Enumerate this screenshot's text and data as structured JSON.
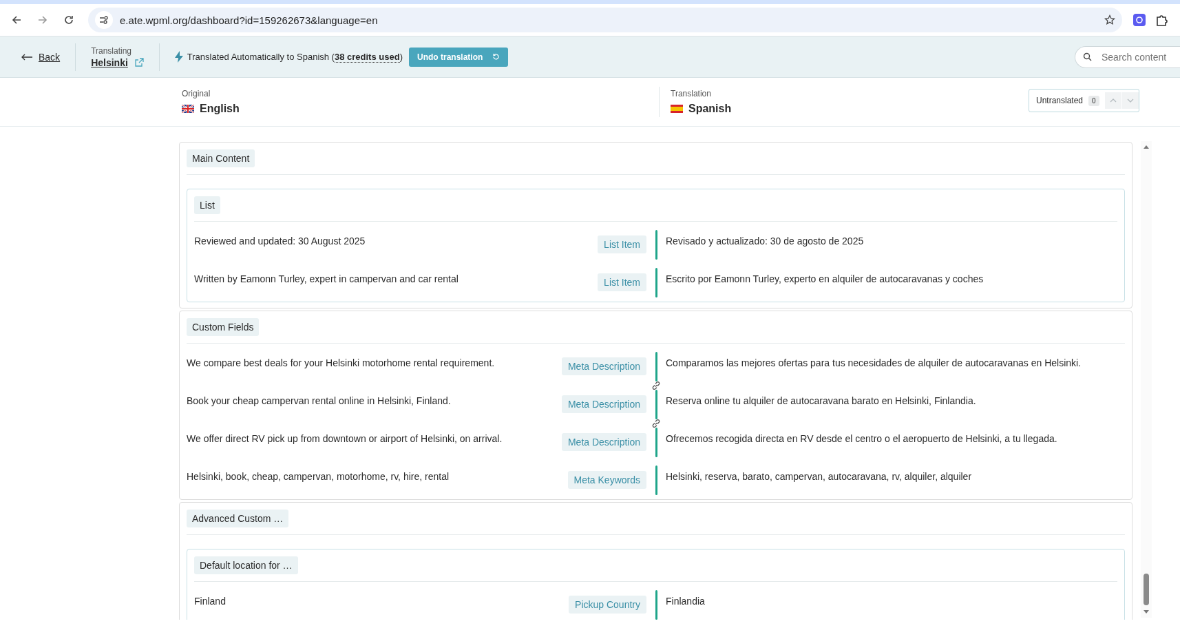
{
  "browser": {
    "url": "e.ate.wpml.org/dashboard?id=159262673&language=en"
  },
  "header": {
    "back": "Back",
    "translating_label": "Translating",
    "post_title": "Helsinki",
    "status": "Translated Automatically to Spanish (**38 credits used**)",
    "undo_button": "Undo translation",
    "search": {
      "placeholder": "Search content"
    }
  },
  "languages": {
    "original": {
      "label": "Original",
      "name": "English"
    },
    "translation": {
      "label": "Translation",
      "name": "Spanish"
    },
    "untranslated": {
      "label": "Untranslated",
      "count": "0"
    }
  },
  "sections": [
    {
      "title": "Main Content",
      "items": [
        {
          "kind": "group",
          "title": "List",
          "rows": [
            {
              "source": "Reviewed and updated: 30 August 2025",
              "field": "List Item",
              "target": "Revisado y actualizado: 30 de agosto de 2025",
              "linked_to_next": false
            },
            {
              "source": "Written by Eamonn Turley, expert in campervan and car rental",
              "field": "List Item",
              "target": "Escrito por Eamonn Turley, experto en alquiler de autocaravanas y coches",
              "linked_to_next": false
            }
          ]
        }
      ]
    },
    {
      "title": "Custom Fields",
      "items": [
        {
          "kind": "row",
          "source": "We compare best deals for your Helsinki motorhome rental requirement.",
          "field": "Meta Description",
          "target": "Comparamos las mejores ofertas para tus necesidades de alquiler de autocaravanas en Helsinki.",
          "linked_to_next": true
        },
        {
          "kind": "row",
          "source": "Book your cheap campervan rental online in Helsinki, Finland.",
          "field": "Meta Description",
          "target": "Reserva online tu alquiler de autocaravana barato en Helsinki, Finlandia.",
          "linked_to_next": true
        },
        {
          "kind": "row",
          "source": "We offer direct RV pick up from downtown or airport of Helsinki, on arrival.",
          "field": "Meta Description",
          "target": "Ofrecemos recogida directa en RV desde el centro o el aeropuerto de Helsinki, a tu llegada.",
          "linked_to_next": false
        },
        {
          "kind": "row",
          "source": "Helsinki, book, cheap, campervan, motorhome, rv, hire, rental",
          "field": "Meta Keywords",
          "target": "Helsinki, reserva, barato, campervan, autocaravana, rv, alquiler, alquiler",
          "linked_to_next": false
        }
      ]
    },
    {
      "title": "Advanced Custom …",
      "items": [
        {
          "kind": "group",
          "title": "Default location for …",
          "rows": [
            {
              "source": "Finland",
              "field": "Pickup Country",
              "target": "Finlandia",
              "linked_to_next": false
            }
          ]
        }
      ]
    }
  ]
}
